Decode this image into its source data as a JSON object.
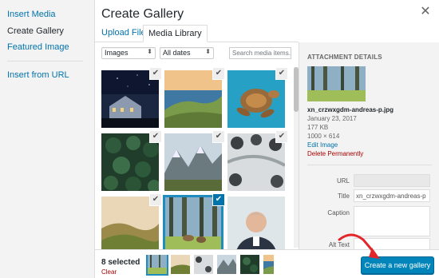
{
  "menu": {
    "items": [
      {
        "label": "Insert Media",
        "active": false
      },
      {
        "label": "Create Gallery",
        "active": true
      },
      {
        "label": "Featured Image",
        "active": false
      },
      {
        "label": "Insert from URL",
        "active": false
      }
    ]
  },
  "frame": {
    "title": "Create Gallery",
    "close_icon": "close-icon"
  },
  "tabs": [
    {
      "label": "Upload Files",
      "active": false
    },
    {
      "label": "Media Library",
      "active": true
    }
  ],
  "toolbar": {
    "type_filter": "Images",
    "date_filter": "All dates",
    "search_placeholder": "Search media items..."
  },
  "attachments": [
    {
      "name": "night-house",
      "selected": true,
      "current": false
    },
    {
      "name": "coast-cliff",
      "selected": true,
      "current": false
    },
    {
      "name": "sea-turtle",
      "selected": true,
      "current": false
    },
    {
      "name": "pine-forest",
      "selected": true,
      "current": false
    },
    {
      "name": "mountains",
      "selected": true,
      "current": false
    },
    {
      "name": "snowy-trees",
      "selected": true,
      "current": false
    },
    {
      "name": "green-hills",
      "selected": true,
      "current": false
    },
    {
      "name": "deer-forest",
      "selected": true,
      "current": true
    },
    {
      "name": "man-portrait",
      "selected": false,
      "current": false
    }
  ],
  "details": {
    "heading": "ATTACHMENT DETAILS",
    "filename": "xn_crzwxgdm-andreas-p.jpg",
    "date": "January 23, 2017",
    "size": "177 KB",
    "dimensions": "1000 × 614",
    "edit_link": "Edit Image",
    "delete_link": "Delete Permanently"
  },
  "fields": {
    "url_label": "URL",
    "url_value": "",
    "title_label": "Title",
    "title_value": "xn_crzwxgdm-andreas-p",
    "caption_label": "Caption",
    "alt_label": "Alt Text"
  },
  "footer": {
    "count": "8 selected",
    "clear": "Clear",
    "button": "Create a new gallery"
  },
  "colors": {
    "accent": "#0085ba",
    "link": "#0073aa",
    "danger": "#a00",
    "annotation_arrow": "#e2262a"
  }
}
